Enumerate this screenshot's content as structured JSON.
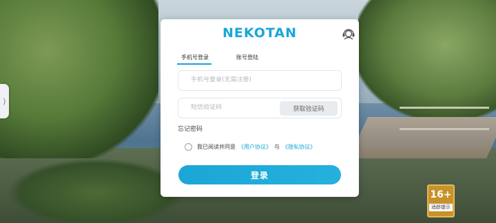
{
  "side_tab": {
    "glyph": "⟩"
  },
  "logo": {
    "text": "NEKOTAN",
    "color": "#1aa6d9"
  },
  "tabs": [
    {
      "label": "手机号登录",
      "active": true
    },
    {
      "label": "账号登陆",
      "active": false
    }
  ],
  "phone_field": {
    "placeholder": "手机号登录(无需注册)",
    "value": ""
  },
  "code_field": {
    "placeholder": "短信验证码",
    "value": ""
  },
  "get_code_button": {
    "label": "获取验证码"
  },
  "forgot_password": {
    "label": "忘记密码"
  },
  "agreement": {
    "text_before": "我已阅读并同意",
    "user_agreement": "《用户协议》",
    "connector": "与",
    "privacy_policy": "《隐私协议》",
    "checked": false
  },
  "login_button": {
    "label": "登录",
    "color": "#1ba7d6"
  },
  "age_badge": {
    "rating": "16+",
    "label": "适龄提示"
  },
  "icons": {
    "support": "customer-service-headset-icon"
  }
}
